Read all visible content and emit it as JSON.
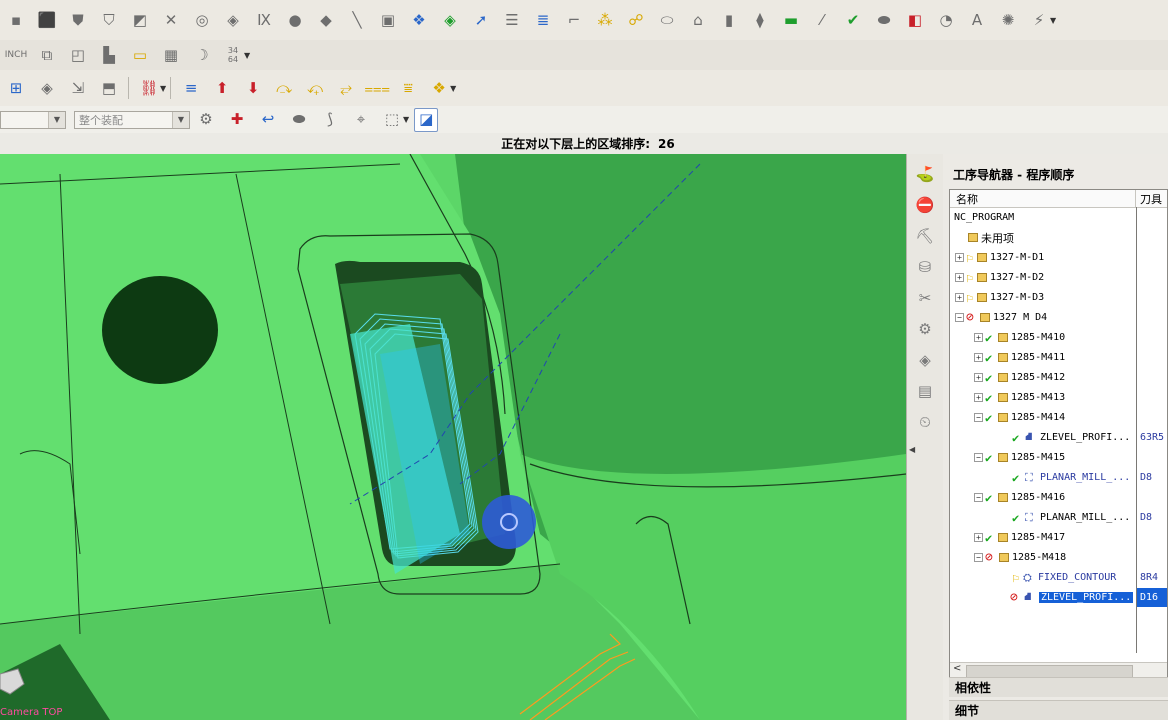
{
  "toolbars": {
    "row1_icons": [
      "block-icon",
      "cylinder-icon",
      "cone-icon",
      "sphere-icon",
      "extrude-icon",
      "revolve-icon",
      "hole-icon",
      "boss-icon",
      "pocket-icon",
      "pad-icon",
      "slot-icon",
      "groove-icon",
      "sketch-icon",
      "transform-icon",
      "trim-icon",
      "program-icon",
      "arrow-icon",
      "list-icon",
      "sort-icon",
      "tree-icon",
      "link-icon",
      "part-icon",
      "axis-icon",
      "measure-icon",
      "rectangle-icon",
      "curve-icon",
      "check-icon",
      "shading-icon",
      "box-icon",
      "point-icon",
      "text-icon",
      "fill-icon",
      "gear-icon",
      "more-icon"
    ],
    "row2_icons": [
      "inch-icon",
      "stack-icon",
      "layer-icon",
      "window-icon",
      "save-icon",
      "page-icon",
      "moon-icon"
    ],
    "row2_fraction": "34\n64",
    "row3_icons": [
      "tree-icon",
      "layers-icon",
      "arrows-icon",
      "cube-icon",
      "connect-icon",
      "down-arrow-icon",
      "up-arrow-icon",
      "down-red-icon",
      "level-icon",
      "level2-icon",
      "level3-icon",
      "level4-icon",
      "level5-icon",
      "level6-icon"
    ],
    "row4": {
      "combo1": "",
      "combo2": "整个装配",
      "icons": [
        "gears-icon",
        "star-icon",
        "undo-icon",
        "ellipse-icon",
        "filter-icon",
        "pin-icon",
        "select-box-icon",
        "cube-view-icon"
      ]
    }
  },
  "status": {
    "label": "正在对以下层上的区域排序:",
    "value": "26"
  },
  "viewport": {
    "label": "Camera TOP"
  },
  "navigator": {
    "title": "工序导航器 - 程序顺序",
    "col_name": "名称",
    "col_tool": "刀具",
    "rows": [
      {
        "name": "NC_PROGRAM",
        "tool": ""
      },
      {
        "name": "未用项",
        "tool": ""
      },
      {
        "name": "1327-M-D1",
        "tool": ""
      },
      {
        "name": "1327-M-D2",
        "tool": ""
      },
      {
        "name": "1327-M-D3",
        "tool": ""
      },
      {
        "name": "1327 M D4",
        "tool": ""
      },
      {
        "name": "1285-M410",
        "tool": ""
      },
      {
        "name": "1285-M411",
        "tool": ""
      },
      {
        "name": "1285-M412",
        "tool": ""
      },
      {
        "name": "1285-M413",
        "tool": ""
      },
      {
        "name": "1285-M414",
        "tool": ""
      },
      {
        "name": "ZLEVEL_PROFI...",
        "tool": "63R5"
      },
      {
        "name": "1285-M415",
        "tool": ""
      },
      {
        "name": "PLANAR_MILL_...",
        "tool": "D8"
      },
      {
        "name": "1285-M416",
        "tool": ""
      },
      {
        "name": "PLANAR_MILL_...",
        "tool": "D8"
      },
      {
        "name": "1285-M417",
        "tool": ""
      },
      {
        "name": "1285-M418",
        "tool": ""
      },
      {
        "name": "FIXED_CONTOUR",
        "tool": "8R4"
      },
      {
        "name": "ZLEVEL_PROFI...",
        "tool": "D16"
      }
    ],
    "section_dependencies": "相依性",
    "section_details": "细节"
  },
  "colors": {
    "model_green": "#5ed86a",
    "selection_blue": "#1560d7",
    "status_ok": "#19a81f",
    "status_error": "#d41717"
  }
}
